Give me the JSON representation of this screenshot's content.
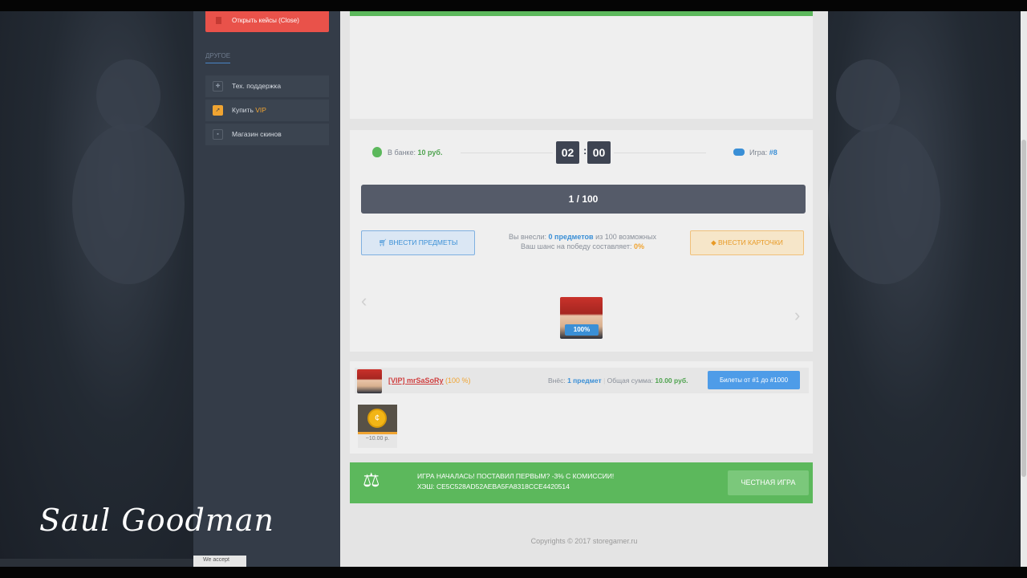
{
  "sidebar": {
    "close_button": "Открыть кейсы (Close)",
    "section_title": "ДРУГОЕ",
    "items": [
      {
        "label": "Тех. поддержка",
        "icon": "support-icon"
      },
      {
        "label_prefix": "Купить ",
        "label_accent": "VIP",
        "icon": "rocket-icon"
      },
      {
        "label": "Магазин скинов",
        "icon": "shop-icon"
      }
    ],
    "bottom_tab": "We accept"
  },
  "game": {
    "bank_label": "В банке:",
    "bank_value": "10 руб.",
    "timer_minutes": "02",
    "timer_seconds": "00",
    "game_label": "Игра:",
    "game_number": "#8",
    "progress_text": "1 / 100",
    "progress_fraction": 0.01,
    "deposit_items_button": "ВНЕСТИ ПРЕДМЕТЫ",
    "deposit_cards_button": "ВНЕСТИ КАРТОЧКИ",
    "chance_line1_prefix": "Вы внесли:",
    "chance_line1_value": "0 предметов",
    "chance_line1_suffix": "из 100 возможных",
    "chance_line2_prefix": "Ваш шанс на победу составляет:",
    "chance_line2_value": "0%",
    "winner_percent": "100%"
  },
  "player": {
    "name": "[VIP] mrSaSoRy",
    "percent": "(100 %)",
    "deposited_label": "Внёс:",
    "deposited_value": "1 предмет",
    "total_label": "Общая сумма:",
    "total_value": "10.00 руб.",
    "tickets_button": "Билеты от #1 до #1000",
    "item_value": "~10.00 р."
  },
  "banner": {
    "line1": "ИГРА НАЧАЛАСЬ! ПОСТАВИЛ ПЕРВЫМ? -3% С КОМИССИИ!",
    "line2": "ХЭШ: CE5C528AD52AEBA5FA8318CCE4420514",
    "fair_button": "ЧЕСТНАЯ ИГРА"
  },
  "footer": {
    "copyright": "Copyrights © 2017 storegamer.ru"
  },
  "overlay": {
    "signature": "Saul Goodman"
  },
  "colors": {
    "green": "#5cb85c",
    "blue": "#3a8fd6",
    "orange": "#f0a431",
    "red": "#e9524a"
  }
}
